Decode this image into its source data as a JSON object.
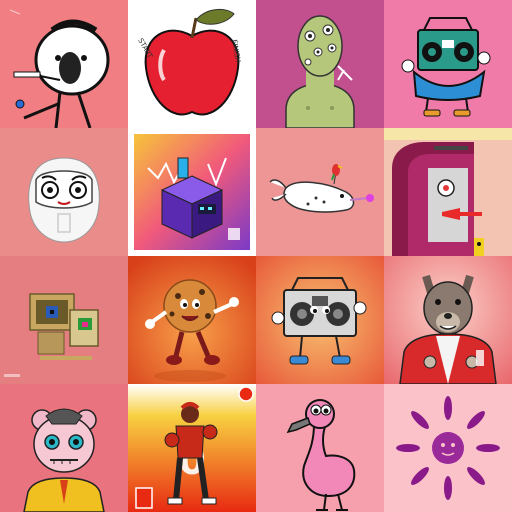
{
  "gallery": {
    "tiles": [
      {
        "name": "stickman-headset-smoking",
        "background": "#f07e82"
      },
      {
        "name": "apple-with-leaf",
        "background": "#ffffff",
        "text_start": "START",
        "text_finish": "FINISH"
      },
      {
        "name": "green-alien-creature",
        "background": "#c24f8e"
      },
      {
        "name": "boombox-character-blue",
        "background": "#f07aa8"
      },
      {
        "name": "daruma-doll",
        "background": "#e98c8a"
      },
      {
        "name": "isometric-game-cube",
        "background": "#ffffff"
      },
      {
        "name": "narwhal-with-parrot",
        "background": "#ee9595"
      },
      {
        "name": "abstract-face-profile",
        "background": "#f3c4b2"
      },
      {
        "name": "retro-computer",
        "background": "#e57e80"
      },
      {
        "name": "cookie-character",
        "background": "#e8562a"
      },
      {
        "name": "boombox-character-shoes",
        "background": "#f18a54"
      },
      {
        "name": "wolf-in-red-jacket",
        "background": "#f6a5a0"
      },
      {
        "name": "robot-faced-bear",
        "background": "#e9737e"
      },
      {
        "name": "boxer-player",
        "background": "#ee2d12",
        "player_number": "0"
      },
      {
        "name": "pink-flamingo",
        "background": "#f5a0ac"
      },
      {
        "name": "purple-flower",
        "background": "#fbc3c9"
      }
    ]
  }
}
